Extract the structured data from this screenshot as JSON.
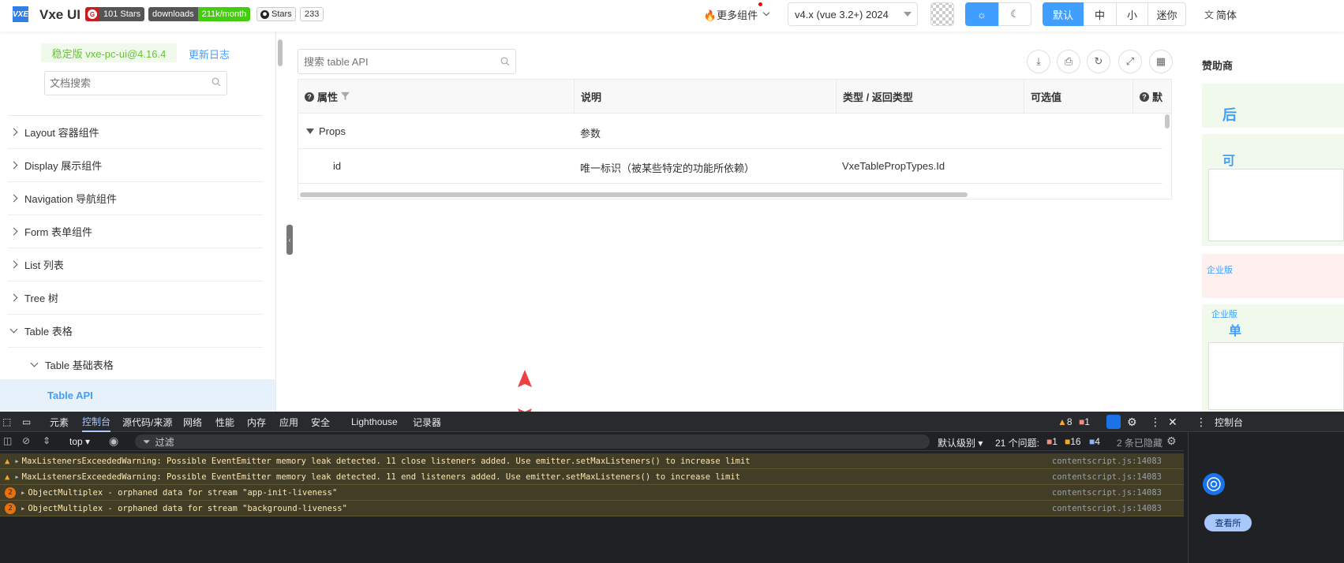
{
  "header": {
    "logo_text": "VXE",
    "brand": "Vxe UI",
    "badge_stars_count": "101 Stars",
    "badge_downloads_label": "downloads",
    "badge_downloads_value": "211k/month",
    "badge_github_label": "Stars",
    "badge_github_count": "233",
    "more_components": "🔥更多组件",
    "version_select": "v4.x (vue 3.2+) 2024",
    "size_default": "默认",
    "size_medium": "中",
    "size_small": "小",
    "size_mini": "迷你",
    "lang": "简体"
  },
  "sidebar": {
    "stable_version": "稳定版 vxe-pc-ui@4.16.4",
    "changelog": "更新日志",
    "search_placeholder": "文档搜索",
    "items": [
      {
        "label": "Layout 容器组件"
      },
      {
        "label": "Display 展示组件"
      },
      {
        "label": "Navigation 导航组件"
      },
      {
        "label": "Form 表单组件"
      },
      {
        "label": "List 列表"
      },
      {
        "label": "Tree 树"
      },
      {
        "label": "Table 表格"
      }
    ],
    "sub_item": "Table 基础表格",
    "active_item": "Table API"
  },
  "main": {
    "search_placeholder": "搜索 table API",
    "columns": [
      "属性",
      "说明",
      "类型 / 返回类型",
      "可选值",
      "默"
    ],
    "group_row": {
      "name": "Props",
      "desc": "参数"
    },
    "rows": [
      {
        "name": "id",
        "desc": "唯一标识（被某些特定的功能所依赖）",
        "type": "VxeTablePropTypes.Id"
      }
    ]
  },
  "rightbar": {
    "title": "赞助商",
    "text1": "后",
    "text2": "可",
    "text3": "企业版",
    "text4": "企业版",
    "text5": "单"
  },
  "devtools": {
    "tabs": [
      "元素",
      "控制台",
      "源代码/来源",
      "网络",
      "性能",
      "内存",
      "应用",
      "安全",
      "Lighthouse",
      "记录器"
    ],
    "active_tab": "控制台",
    "warn_count": "8",
    "error_count": "1",
    "context": "top",
    "filter_placeholder": "过滤",
    "level": "默认级别",
    "issues_label": "21 个问题:",
    "issues_error": "1",
    "issues_warn": "16",
    "issues_info": "4",
    "hidden_label": "2 条已隐藏",
    "side_title": "控制台",
    "side_btn": "查看所",
    "logs": [
      {
        "icon": "warn",
        "text": "MaxListenersExceededWarning: Possible EventEmitter memory leak detected. 11 close listeners added. Use emitter.setMaxListeners() to increase limit",
        "src": "contentscript.js:14083"
      },
      {
        "icon": "warn",
        "text": "MaxListenersExceededWarning: Possible EventEmitter memory leak detected. 11 end listeners added. Use emitter.setMaxListeners() to increase limit",
        "src": "contentscript.js:14083"
      },
      {
        "icon": "count",
        "count": "2",
        "text": "ObjectMultiplex - orphaned data for stream \"app-init-liveness\"",
        "src": "contentscript.js:14083"
      },
      {
        "icon": "count",
        "count": "2",
        "text": "ObjectMultiplex - orphaned data for stream \"background-liveness\"",
        "src": "contentscript.js:14083"
      }
    ]
  },
  "colors": {
    "primary": "#409eff",
    "stable_bg": "#f0f9eb",
    "stable_text": "#67c23a",
    "active_bg": "#e6f1fc",
    "warn_row": "#413d27"
  }
}
